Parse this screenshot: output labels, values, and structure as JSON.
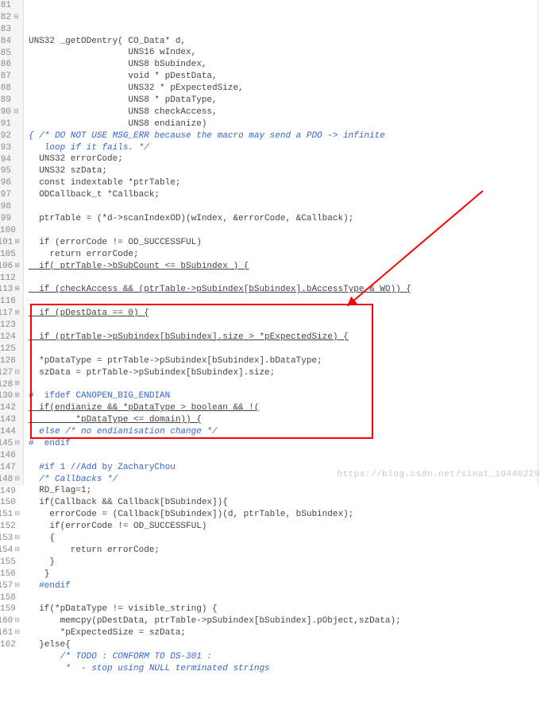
{
  "watermark": "https://blog.csdn.net/sinat_19440229",
  "lines": [
    {
      "n": 81,
      "t": "",
      "f": ""
    },
    {
      "n": 82,
      "t": "UNS32 _getODentry( CO_Data* d,",
      "f": "-"
    },
    {
      "n": 83,
      "t": "                   UNS16 wIndex,",
      "f": ""
    },
    {
      "n": 84,
      "t": "                   UNS8 bSubindex,",
      "f": ""
    },
    {
      "n": 85,
      "t": "                   void * pDestData,",
      "f": ""
    },
    {
      "n": 86,
      "t": "                   UNS32 * pExpectedSize,",
      "f": ""
    },
    {
      "n": 87,
      "t": "                   UNS8 * pDataType,",
      "f": ""
    },
    {
      "n": 88,
      "t": "                   UNS8 checkAccess,",
      "f": ""
    },
    {
      "n": 89,
      "t": "                   UNS8 endianize)",
      "f": ""
    },
    {
      "n": 90,
      "t": "{ /* DO NOT USE MSG_ERR because the macro may send a PDO -> infinite",
      "f": "-",
      "cls": "cm"
    },
    {
      "n": 91,
      "t": "   loop if it fails. */",
      "f": "",
      "cls": "cm"
    },
    {
      "n": 92,
      "t": "  UNS32 errorCode;",
      "f": ""
    },
    {
      "n": 93,
      "t": "  UNS32 szData;",
      "f": ""
    },
    {
      "n": 94,
      "t": "  const indextable *ptrTable;",
      "f": ""
    },
    {
      "n": 95,
      "t": "  ODCallback_t *Callback;",
      "f": ""
    },
    {
      "n": 96,
      "t": "",
      "f": ""
    },
    {
      "n": 97,
      "t": "  ptrTable = (*d->scanIndexOD)(wIndex, &errorCode, &Callback);",
      "f": ""
    },
    {
      "n": 98,
      "t": "",
      "f": ""
    },
    {
      "n": 99,
      "t": "  if (errorCode != OD_SUCCESSFUL)",
      "f": ""
    },
    {
      "n": 100,
      "t": "    return errorCode;",
      "f": ""
    },
    {
      "n": 101,
      "t": "  if( ptrTable->bSubCount <= bSubindex ) {",
      "f": "+",
      "fu": true
    },
    {
      "n": 105,
      "t": "",
      "f": ""
    },
    {
      "n": 106,
      "t": "  if (checkAccess && (ptrTable->pSubindex[bSubindex].bAccessType & WO)) {",
      "f": "+",
      "fu": true
    },
    {
      "n": 112,
      "t": "",
      "f": ""
    },
    {
      "n": 113,
      "t": "  if (pDestData == 0) {",
      "f": "+",
      "fu": true
    },
    {
      "n": 116,
      "t": "",
      "f": ""
    },
    {
      "n": 117,
      "t": "  if (ptrTable->pSubindex[bSubindex].size > *pExpectedSize) {",
      "f": "+",
      "fu": true
    },
    {
      "n": 123,
      "t": "",
      "f": ""
    },
    {
      "n": 124,
      "t": "  *pDataType = ptrTable->pSubindex[bSubindex].bDataType;",
      "f": ""
    },
    {
      "n": 125,
      "t": "  szData = ptrTable->pSubindex[bSubindex].size;",
      "f": ""
    },
    {
      "n": 126,
      "t": "",
      "f": ""
    },
    {
      "n": 127,
      "t": "#  ifdef CANOPEN_BIG_ENDIAN",
      "f": "-",
      "cls": "pp"
    },
    {
      "n": 128,
      "t": "  if(endianize && *pDataType > boolean && !(",
      "f": "+",
      "fu": true
    },
    {
      "n": 130,
      "t": "         *pDataType <= domain)) {",
      "f": "+",
      "fu": true
    },
    {
      "n": 142,
      "t": "  else /* no endianisation change */",
      "f": "",
      "cls": "cm"
    },
    {
      "n": 143,
      "t": "#  endif",
      "f": "",
      "cls": "pp"
    },
    {
      "n": 144,
      "t": "",
      "f": ""
    },
    {
      "n": 145,
      "t": "  #if 1 //Add by ZacharyChou",
      "f": "-",
      "cls": "pp"
    },
    {
      "n": 146,
      "t": "  /* Callbacks */",
      "f": "",
      "cls": "cm"
    },
    {
      "n": 147,
      "t": "  RD_Flag=1;",
      "f": ""
    },
    {
      "n": 148,
      "t": "  if(Callback && Callback[bSubindex]){",
      "f": "-"
    },
    {
      "n": 149,
      "t": "    errorCode = (Callback[bSubindex])(d, ptrTable, bSubindex);",
      "f": ""
    },
    {
      "n": 150,
      "t": "    if(errorCode != OD_SUCCESSFUL)",
      "f": ""
    },
    {
      "n": 151,
      "t": "    {",
      "f": "-"
    },
    {
      "n": 152,
      "t": "        return errorCode;",
      "f": ""
    },
    {
      "n": 153,
      "t": "    }",
      "f": "-"
    },
    {
      "n": 154,
      "t": "   }",
      "f": "-"
    },
    {
      "n": 155,
      "t": "  #endif",
      "f": "",
      "cls": "pp"
    },
    {
      "n": 156,
      "t": "",
      "f": ""
    },
    {
      "n": 157,
      "t": "  if(*pDataType != visible_string) {",
      "f": "-"
    },
    {
      "n": 158,
      "t": "      memcpy(pDestData, ptrTable->pSubindex[bSubindex].pObject,szData);",
      "f": ""
    },
    {
      "n": 159,
      "t": "      *pExpectedSize = szData;",
      "f": ""
    },
    {
      "n": 160,
      "t": "  }else{",
      "f": "-"
    },
    {
      "n": 161,
      "t": "      /* TODO : CONFORM TO DS-301 :",
      "f": "-",
      "cls": "cm"
    },
    {
      "n": 162,
      "t": "       *  - stop using NULL terminated strings",
      "f": "",
      "cls": "cm"
    }
  ]
}
